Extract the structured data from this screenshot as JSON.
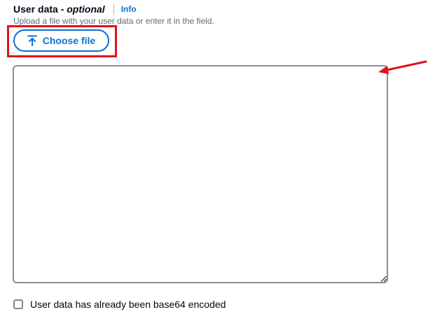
{
  "field": {
    "label": "User data - ",
    "label_optional": "optional",
    "info_link": "Info",
    "description": "Upload a file with your user data or enter it in the field."
  },
  "upload": {
    "button_label": "Choose file",
    "icon": "upload-arrow-icon"
  },
  "textarea": {
    "value": "",
    "placeholder": ""
  },
  "checkbox": {
    "label": "User data has already been base64 encoded",
    "checked": false
  },
  "annotations": {
    "highlight_color": "#e0121d",
    "arrow_color": "#e0121d"
  },
  "colors": {
    "link_blue": "#0972d3",
    "text": "#000716",
    "secondary_text": "#5f6b7a",
    "border": "#8c8c94"
  }
}
